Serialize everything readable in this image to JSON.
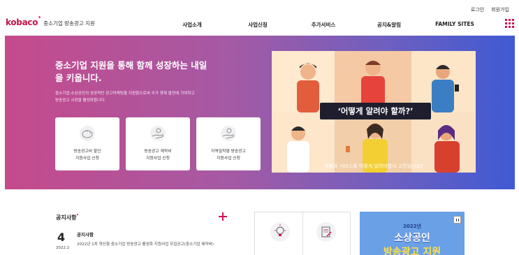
{
  "utility": {
    "login": "로그인",
    "signup": "회원가입"
  },
  "logo": {
    "mark": "kobaco",
    "subtitle": "중소기업 방송광고 지원"
  },
  "nav": {
    "items": [
      {
        "label": "사업소개"
      },
      {
        "label": "사업신청"
      },
      {
        "label": "추가서비스"
      },
      {
        "label": "공지&알림"
      },
      {
        "label": "FAMILY SITES"
      }
    ]
  },
  "hero": {
    "title": "중소기업 지원을 통해 함께 성장하는 내일을 키웁니다.",
    "description": "중소기업·소상공인의 성공적인 광고마케팅을 지원함으로써 국가 경제 발전에 기여하고 방송광고 시장을 활성화합니다.",
    "cards": [
      {
        "label": "방송광고비 할인\n지원사업 신청",
        "icon": "piggy-bank-icon"
      },
      {
        "label": "방송광고 제작비\n지원사업 신청",
        "icon": "hand-coin-icon"
      },
      {
        "label": "지역밀착형 방송광고\n지원사업 신청",
        "icon": "hand-coin-icon"
      }
    ],
    "video": {
      "headline": "‘어떻게 알려야 할까?’",
      "caption": "제품과 서비스를 어떻게 알려야할지 고민되시죠?"
    }
  },
  "notice": {
    "title": "공지사항",
    "day": "4",
    "year_month": "2022.2",
    "category": "공지사항",
    "text": "2022년 1차 혁신형 중소기업 방송광고 활성화 지원사업 모집공고(중소기업 제작비)"
  },
  "promo": {
    "year": "2022년",
    "line1": "소상공인",
    "line2": "방송광고 지원"
  },
  "colors": {
    "accent": "#d3134c",
    "hero_start": "#c54a8c",
    "hero_end": "#3f5ad3"
  }
}
